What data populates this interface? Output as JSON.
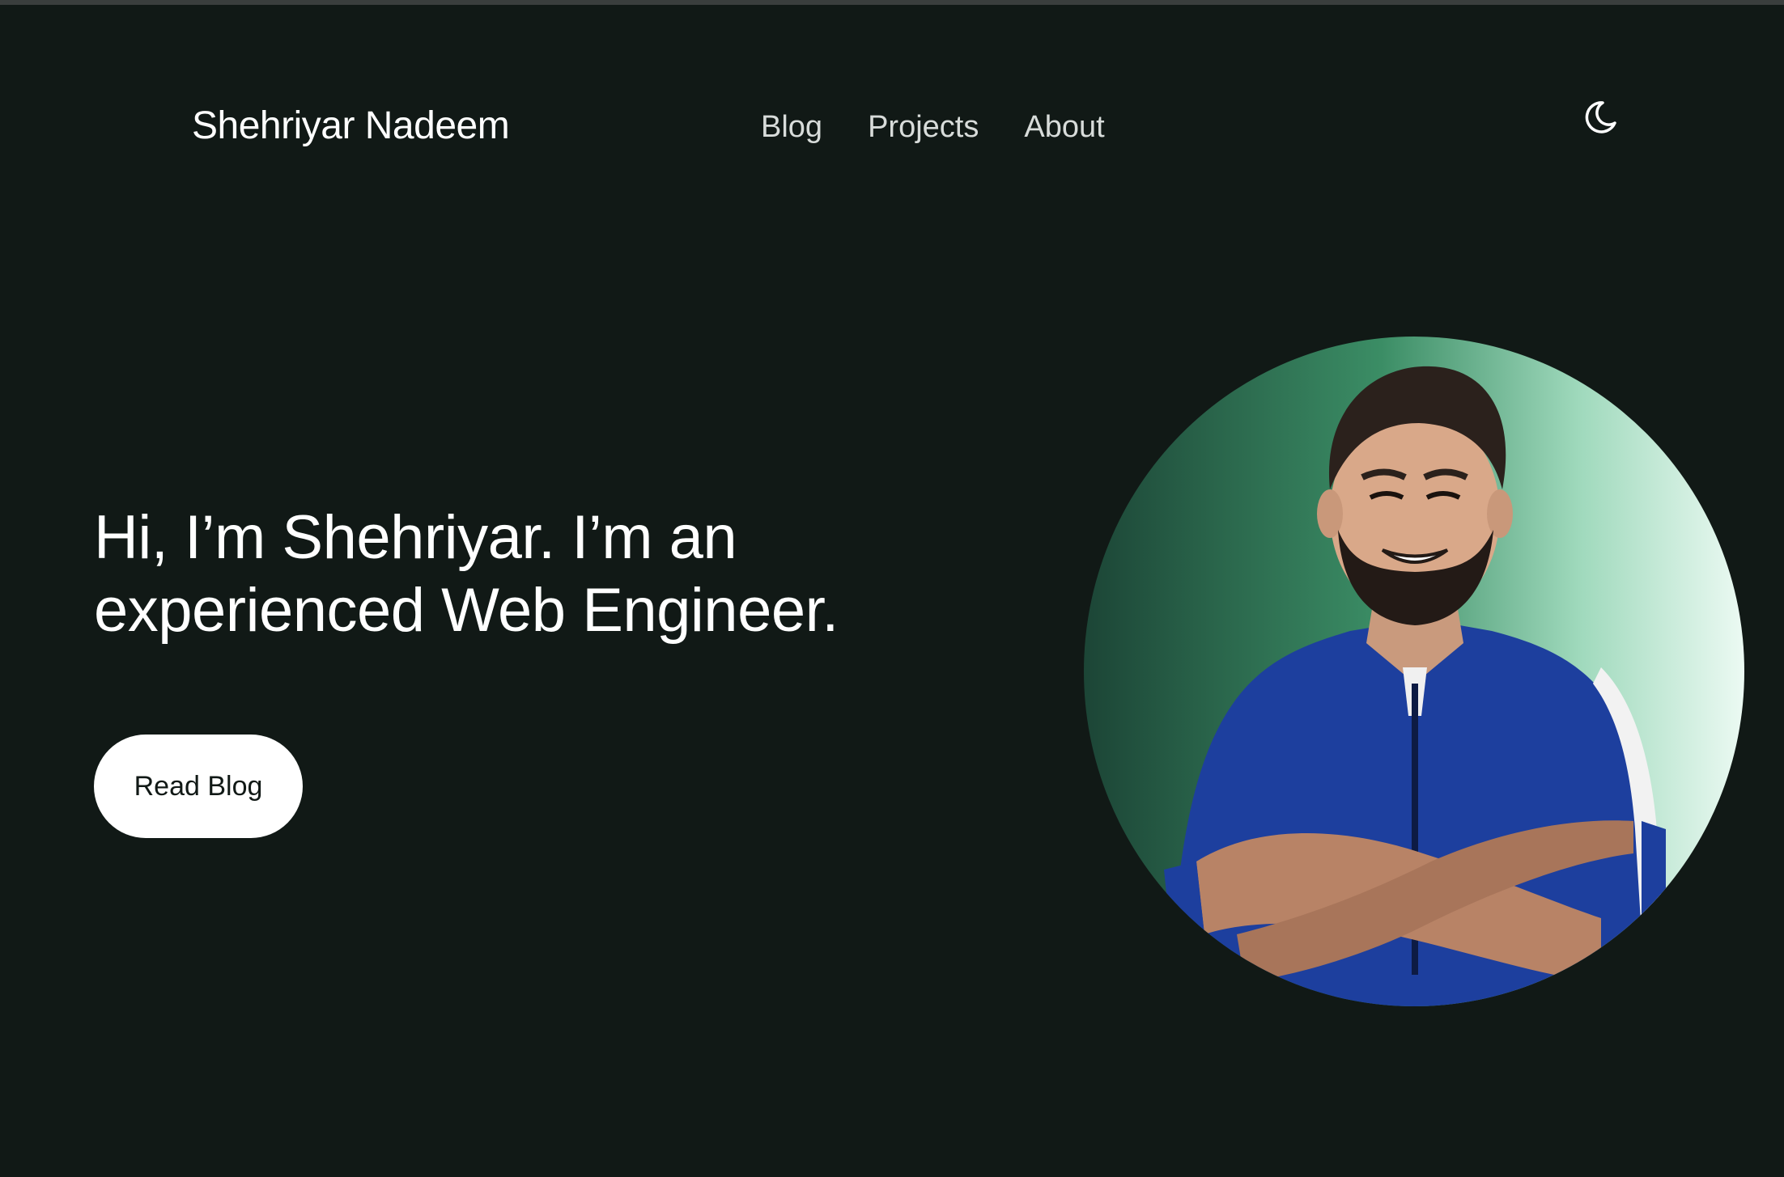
{
  "header": {
    "brand": "Shehriyar Nadeem",
    "nav": [
      "Blog",
      "Projects",
      "About"
    ],
    "theme_icon": "moon-icon"
  },
  "hero": {
    "heading_line1": "Hi, I’m Shehriyar. I’m an",
    "heading_line2": "experienced Web Engineer.",
    "cta_label": "Read Blog"
  },
  "colors": {
    "background": "#111916",
    "text": "#ffffff",
    "button_bg": "#ffffff",
    "button_text": "#111916",
    "avatar_gradient_dark": "#1e4a3a",
    "avatar_gradient_mid": "#3f8f68",
    "avatar_gradient_light": "#e8f7f0"
  },
  "avatar": {
    "subject_shirt_color": "#1d3f9e"
  }
}
